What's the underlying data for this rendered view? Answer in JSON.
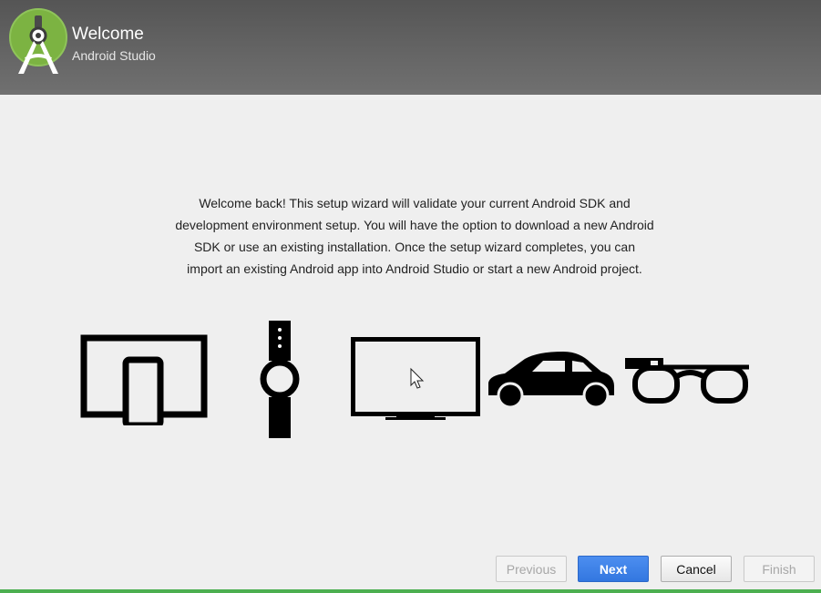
{
  "header": {
    "title": "Welcome",
    "subtitle": "Android Studio"
  },
  "main": {
    "intro_lines": [
      "Welcome back! This setup wizard will validate your current Android SDK and",
      "development environment setup. You will have the option to download a new Android",
      "SDK or use an existing installation. Once the setup wizard completes, you can",
      "import an existing Android app into Android Studio or start a new Android project."
    ],
    "devices": [
      "tablet-phone-icon",
      "watch-icon",
      "tv-icon",
      "car-icon",
      "glass-icon"
    ]
  },
  "footer": {
    "previous_label": "Previous",
    "next_label": "Next",
    "cancel_label": "Cancel",
    "finish_label": "Finish"
  },
  "colors": {
    "header": "#5f5f5f",
    "logo_green": "#7cb342",
    "primary_button": "#3a7fe6",
    "bottom_accent": "#4caf50"
  }
}
